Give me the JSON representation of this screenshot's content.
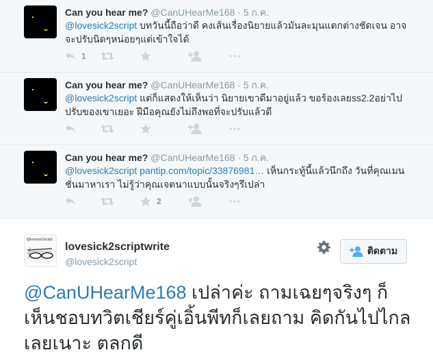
{
  "replies": [
    {
      "name": "Can you hear me?",
      "handle": "@CanUHearMe168",
      "separator": "·",
      "time": "5 ก.ค.",
      "mention": "@lovesick2script",
      "text": " บทวันนี้ถือว่าดี คงเส้นเรื่องนิยายแล้วมันละมุนแตกต่างชัดเจน อาจจะปรับนิดๆหน่อยๆแต่เข้าใจได้",
      "reply_count": "1",
      "retweet_count": "",
      "favorite_count": ""
    },
    {
      "name": "Can you hear me?",
      "handle": "@CanUHearMe168",
      "separator": "·",
      "time": "5 ก.ค.",
      "mention": "@lovesick2script",
      "text": " แต่ก็แสดงให้เห็นว่า นิยายเขาดีมาอยู่แล้ว ขอร้องเลยss2.2อย่าไปปรับของเขาเยอะ ฝีมือคุณยังไม่ถึงพอที่จะปรับแล้วดี",
      "reply_count": "",
      "retweet_count": "",
      "favorite_count": ""
    },
    {
      "name": "Can you hear me?",
      "handle": "@CanUHearMe168",
      "separator": "·",
      "time": "5 ก.ค.",
      "mention": "@lovesick2script",
      "link": " pantip.com/topic/33876981…",
      "text": " เห็นกระทู้นี้แล้วนึกถึง วันที่คุณเมนชั่นมาหาเรา ไม่รู้ว่าคุณเจตนาแบบนั้นจริงๆรึเปล่า",
      "reply_count": "",
      "retweet_count": "",
      "favorite_count": "2"
    }
  ],
  "main_tweet": {
    "avatar_text": "@lovesick2script",
    "name": "lovesick2scriptwrite",
    "handle": "@lovesick2script",
    "follow_label": "ติดตาม",
    "mention": "@CanUHearMe168",
    "text": " เปล่าค่ะ ถามเฉยๆจริงๆ ก็เห็นชอบทวิตเชียร์คู่เอิ้นพีทก็เลยถาม คิดกันไปไกลเลยเนาะ ตลกดี"
  },
  "colors": {
    "link": "#2b7bb9",
    "muted": "#8899a6",
    "text": "#292f33",
    "icon": "#ccd6dd"
  },
  "icons": [
    "reply-icon",
    "retweet-icon",
    "favorite-icon",
    "follow-icon",
    "more-icon",
    "gear-icon"
  ]
}
